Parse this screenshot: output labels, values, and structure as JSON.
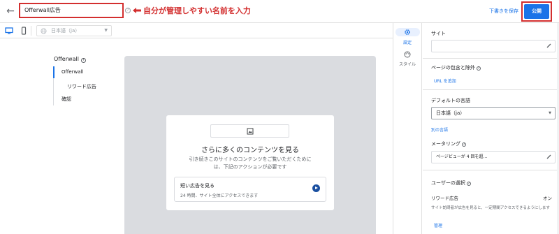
{
  "header": {
    "name_value": "Offerwall広告",
    "annotation": "自分が管理しやすい名前を入力",
    "save_draft": "下書きを保存",
    "publish": "公開"
  },
  "toolbar": {
    "language": "日本語（ja）"
  },
  "nav": {
    "title": "Offerwall",
    "items": [
      "Offerwall",
      "リワード広告",
      "確認"
    ]
  },
  "preview": {
    "title": "さらに多くのコンテンツを見る",
    "desc_line1": "引き続きこのサイトのコンテンツをご覧いただくために",
    "desc_line2": "は、下記のアクションが必要です",
    "ad_title": "短い広告を見る",
    "ad_sub": "24 時間、サイト全体にアクセスできます"
  },
  "tabs": {
    "settings": "設定",
    "style": "スタイル"
  },
  "panel": {
    "site_label": "サイト",
    "page_label": "ページの包含と除外",
    "add_url": "URL を追加",
    "default_lang_label": "デフォルトの言語",
    "default_lang_value": "日本語（ja）",
    "other_lang": "別の言語",
    "metering_label": "メータリング",
    "metering_value": "ページビューが 4 回を超...",
    "user_choice_label": "ユーザーの選択",
    "rewarded_label": "リワード広告",
    "rewarded_state": "オン",
    "rewarded_desc": "サイト訪問者が広告を見ると、一定期間アクセスできるようにします",
    "manage": "管理"
  },
  "colors": {
    "accent": "#1a73e8",
    "annotation": "#d32f2f",
    "preview_bg": "#dadce0"
  },
  "icons": [
    "back-arrow-icon",
    "help-icon",
    "desktop-icon",
    "mobile-icon",
    "globe-icon",
    "image-icon",
    "gear-icon",
    "palette-icon",
    "pencil-icon",
    "play-arrow-icon"
  ]
}
